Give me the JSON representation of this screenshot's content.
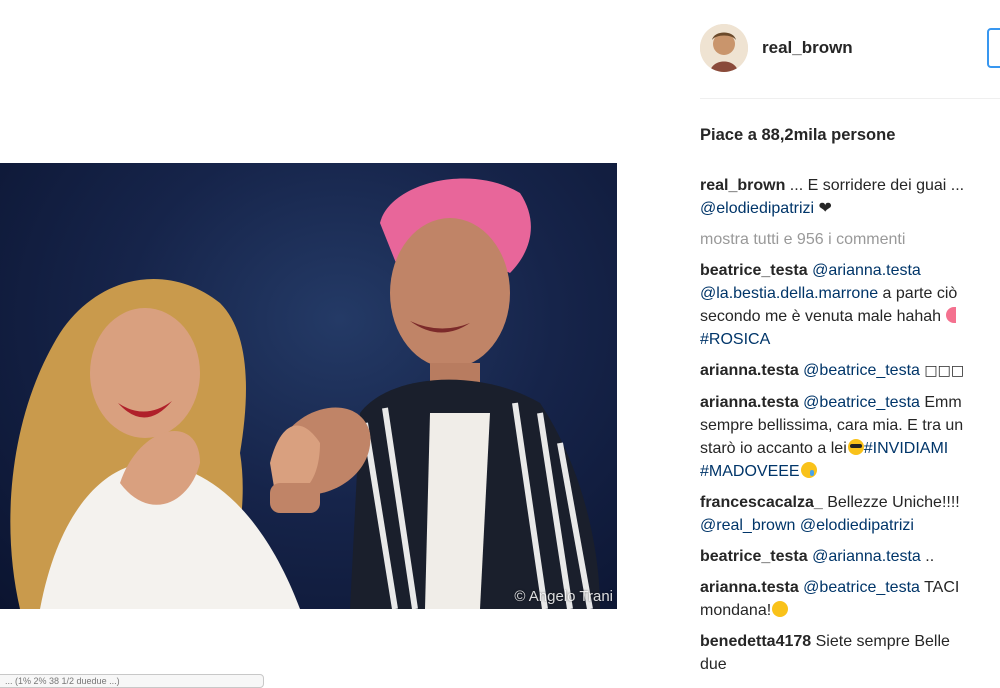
{
  "post": {
    "photo_credit": "© Angelo Trani",
    "bottom_stub_text": "... (1% 2% 38 1/2 duedue ...)"
  },
  "header": {
    "username": "real_brown"
  },
  "likes_text": "Piace a 88,2mila persone",
  "caption": {
    "user": "real_brown",
    "text": " ... E sorridere dei guai ...",
    "mention": "@elodiedipatrizi",
    "heart": " ❤"
  },
  "show_all_comments": "mostra tutti e 956 i commenti",
  "comments": [
    {
      "user": "beatrice_testa",
      "mention1": "@arianna.testa",
      "mention2": "@la.bestia.della.marrone",
      "text1": " a parte ciò",
      "text2": "secondo me è venuta male hahah ",
      "hashtag": "#ROSICA"
    },
    {
      "user": "arianna.testa",
      "mention": "@beatrice_testa",
      "text": " □□□"
    },
    {
      "user": "arianna.testa",
      "mention": "@beatrice_testa",
      "text1": " Emm",
      "text2": "sempre bellissima, cara mia. E tra un",
      "text3": "starò io accanto a lei",
      "hashtag1": "#INVIDIAMI",
      "hashtag2": "#MADOVEEE"
    },
    {
      "user": "francescacalza_",
      "text": " Bellezze Uniche!!!!",
      "mention1": "@real_brown",
      "mention2": "@elodiedipatrizi"
    },
    {
      "user": "beatrice_testa",
      "mention": "@arianna.testa",
      "text": " .."
    },
    {
      "user": "arianna.testa",
      "mention": "@beatrice_testa",
      "text1": " TACI",
      "text2": "mondana!"
    },
    {
      "user": "benedetta4178",
      "text1": " Siete sempre Belle",
      "text2": "due"
    }
  ],
  "colors": {
    "link": "#003569",
    "muted": "#999999",
    "text": "#262626",
    "accent": "#3897f0"
  }
}
